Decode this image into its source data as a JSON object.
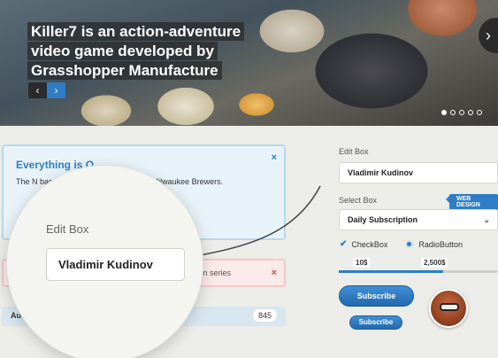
{
  "hero": {
    "title": "Killer7 is an action-adventure video game developed by Grasshopper Manufacture",
    "prev_icon": "‹",
    "next_icon": "›",
    "side_arrow_icon": "›",
    "dots_total": 5,
    "active_dot": 1
  },
  "left": {
    "info_title": "Everything is O",
    "info_close": "×",
    "info_text": "The N                                      baseball team of the Pacific Co                                       Milwaukee Brewers.",
    "error_text": "tevision series",
    "error_close": "×",
    "bar_label": "Au",
    "bar_count": "845"
  },
  "magnifier": {
    "label": "Edit Box",
    "value": "Vladimir Kudinov"
  },
  "right": {
    "edit_label": "Edit Box",
    "edit_value": "Vladimir Kudinov",
    "select_label": "Select Box",
    "badge": "WEB DESIGN",
    "select_value": "Daily Subscription",
    "chevron": "⌄",
    "checkbox_label": "CheckBox",
    "radio_label": "RadioButton",
    "slider_min": "10$",
    "slider_max": "2,500$",
    "subscribe_large": "Subscribe",
    "subscribe_small": "Subscribe"
  },
  "colors": {
    "accent": "#2f7dc4",
    "info_border": "#b9d8ea",
    "error_border": "#f1c9c9",
    "background": "#ecece8"
  },
  "icons": {
    "prev": "chevron-left-icon",
    "next": "chevron-right-icon",
    "close": "close-icon",
    "check": "check-icon",
    "radio": "radio-icon"
  }
}
